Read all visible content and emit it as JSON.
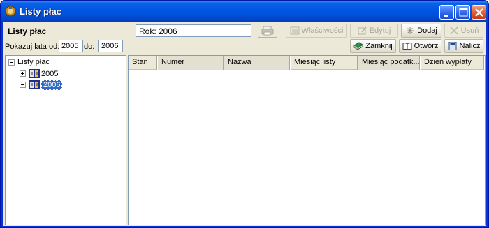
{
  "window": {
    "title": "Listy płac",
    "icon": "app-icon"
  },
  "header": {
    "label": "Listy płac",
    "year_field_value": "Rok: 2006"
  },
  "toolbar": {
    "properties": "Właściwości",
    "edit": "Edytuj",
    "add": "Dodaj",
    "delete": "Usuń",
    "close": "Zamknij",
    "open": "Otwórz",
    "calculate": "Nalicz"
  },
  "filter": {
    "from_label": "Pokazuj lata od:",
    "from_value": "2005",
    "to_label": "do:",
    "to_value": "2006"
  },
  "tree": {
    "root": "Listy płac",
    "children": [
      {
        "label": "2005",
        "expanded": false,
        "selected": false
      },
      {
        "label": "2006",
        "expanded": true,
        "selected": true
      }
    ]
  },
  "grid": {
    "columns": [
      "Stan",
      "Numer",
      "Nazwa",
      "Miesiąc listy",
      "Miesiąc podatk...",
      "Dzień wypłaty"
    ],
    "rows": []
  }
}
